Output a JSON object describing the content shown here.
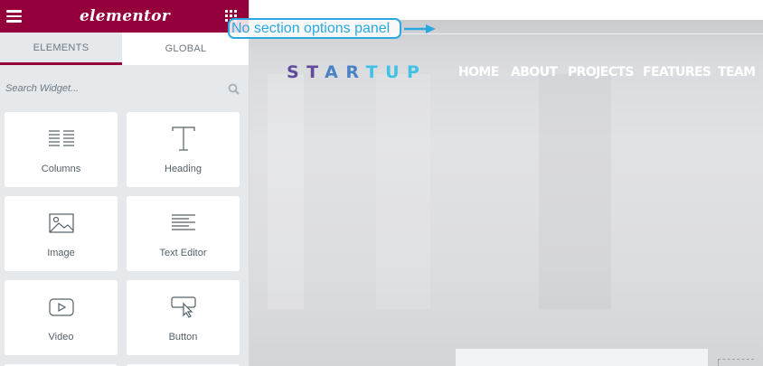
{
  "panel": {
    "logo_text": "elementor",
    "brand_color": "#93003c",
    "tabs": [
      {
        "label": "ELEMENTS",
        "active": true
      },
      {
        "label": "GLOBAL",
        "active": false
      }
    ],
    "search": {
      "placeholder": "Search Widget...",
      "value": ""
    },
    "widgets": [
      {
        "label": "Columns",
        "icon": "columns-icon"
      },
      {
        "label": "Heading",
        "icon": "heading-icon"
      },
      {
        "label": "Image",
        "icon": "image-icon"
      },
      {
        "label": "Text Editor",
        "icon": "text-editor-icon"
      },
      {
        "label": "Video",
        "icon": "video-icon"
      },
      {
        "label": "Button",
        "icon": "button-icon"
      }
    ]
  },
  "preview": {
    "brand": {
      "part1": "ST",
      "part2": "AR",
      "part3": "TUP"
    },
    "nav": [
      "HOME",
      "ABOUT",
      "PROJECTS",
      "FEATURES",
      "TEAM"
    ]
  },
  "annotation": {
    "text": "No section options panel",
    "color": "#29a9e0"
  }
}
